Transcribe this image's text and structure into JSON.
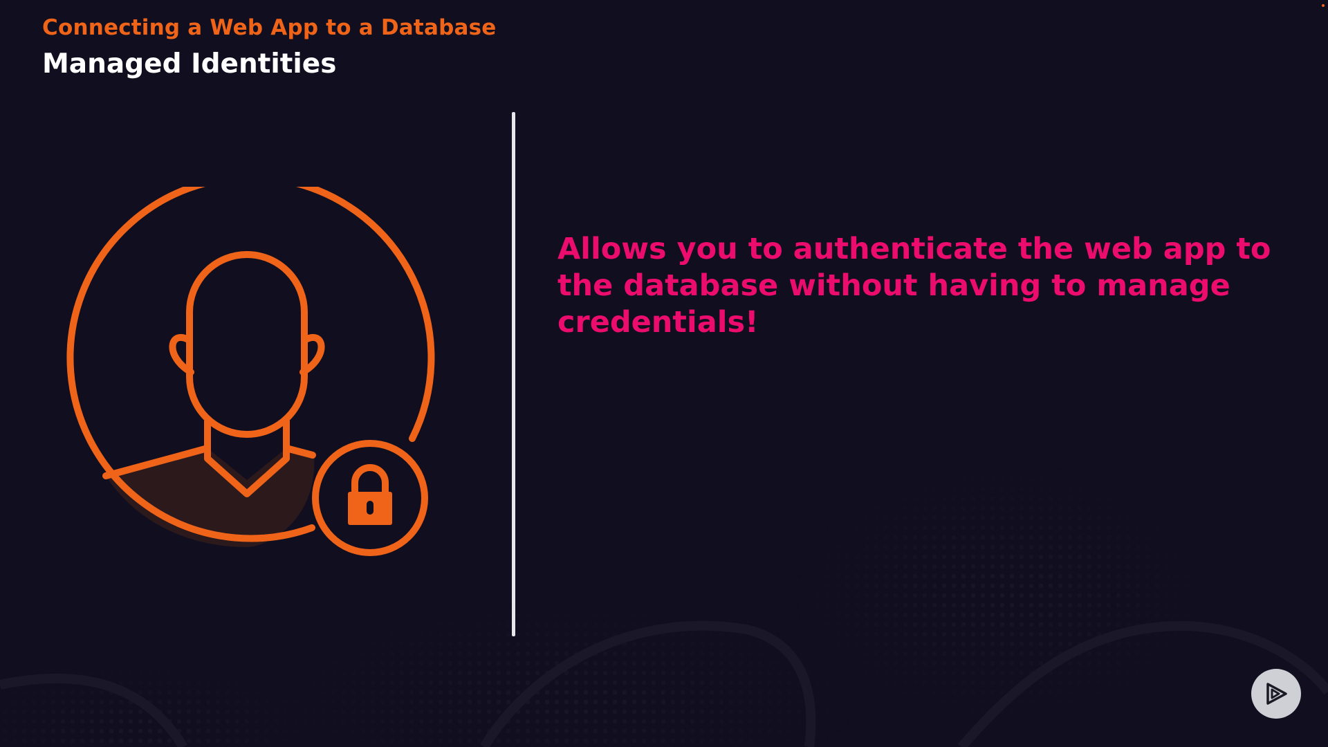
{
  "slide": {
    "kicker": "Connecting a Web App to a Database",
    "title": "Managed Identities",
    "statement": "Allows you to authenticate the web app to the database without having to manage credentials!"
  },
  "illustration": {
    "icon": "user-profile-icon",
    "badge_icon": "lock-icon"
  },
  "controls": {
    "play_icon": "play-logo-icon"
  },
  "colors": {
    "background": "#110f1f",
    "accent_orange": "#f0641a",
    "accent_pink": "#ec0c6e",
    "title": "#ffffff",
    "divider": "#e6e6ec",
    "button": "#cfcfd6"
  }
}
